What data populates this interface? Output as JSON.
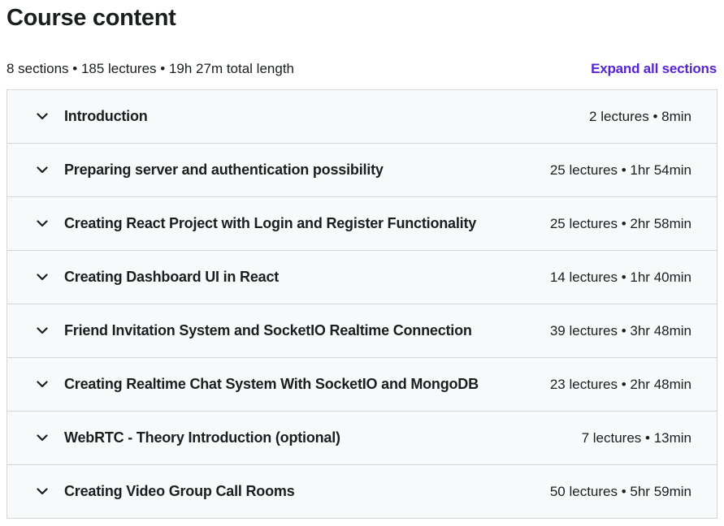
{
  "header": {
    "title": "Course content",
    "summary": "8 sections • 185 lectures • 19h 27m total length",
    "expand_label": "Expand all sections"
  },
  "icons": {
    "section_toggle": "chevron-down-icon"
  },
  "colors": {
    "accent": "#5624d0",
    "text": "#1c1d1f",
    "section_bg": "#f7f9fa",
    "border": "#d1d7dc"
  },
  "sections": [
    {
      "title": "Introduction",
      "meta": "2 lectures • 8min"
    },
    {
      "title": "Preparing server and authentication possibility",
      "meta": "25 lectures • 1hr 54min"
    },
    {
      "title": "Creating React Project with Login and Register Functionality",
      "meta": "25 lectures • 2hr 58min"
    },
    {
      "title": "Creating Dashboard UI in React",
      "meta": "14 lectures • 1hr 40min"
    },
    {
      "title": "Friend Invitation System and SocketIO Realtime Connection",
      "meta": "39 lectures • 3hr 48min"
    },
    {
      "title": "Creating Realtime Chat System With SocketIO and MongoDB",
      "meta": "23 lectures • 2hr 48min"
    },
    {
      "title": "WebRTC - Theory Introduction (optional)",
      "meta": "7 lectures • 13min"
    },
    {
      "title": "Creating Video Group Call Rooms",
      "meta": "50 lectures • 5hr 59min"
    }
  ]
}
